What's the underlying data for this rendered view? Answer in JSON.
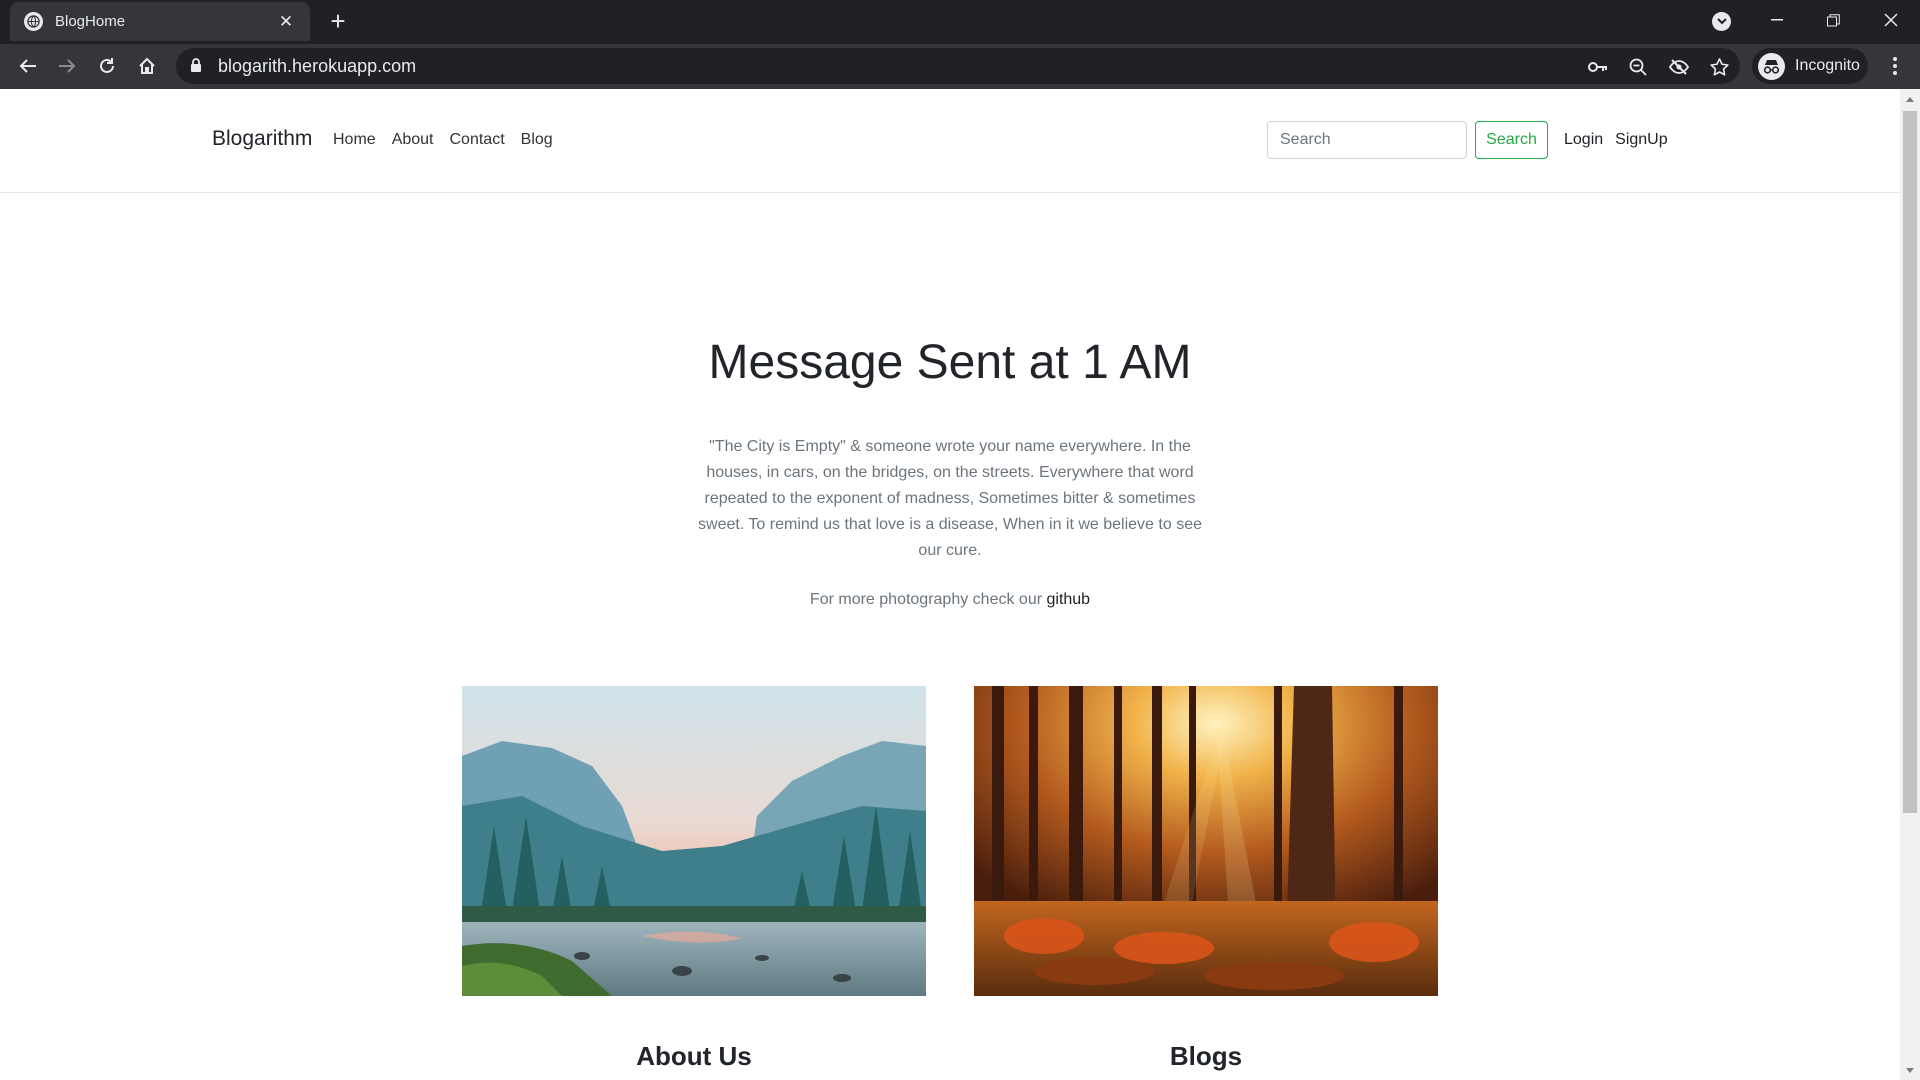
{
  "browser": {
    "tab_title": "BlogHome",
    "url": "blogarith.herokuapp.com",
    "profile_label": "Incognito"
  },
  "navbar": {
    "brand": "Blogarithm",
    "links": [
      "Home",
      "About",
      "Contact",
      "Blog"
    ],
    "search_placeholder": "Search",
    "search_button": "Search",
    "login": "Login",
    "signup": "SignUp"
  },
  "hero": {
    "title": "Message Sent at 1 AM",
    "text": "\"The City is Empty\" & someone wrote your name everywhere. In the houses, in cars, on the bridges, on the streets. Everywhere that word repeated to the exponent of madness, Sometimes bitter & sometimes sweet. To remind us that love is a disease, When in it we believe to see our cure.",
    "more_prefix": "For more photography check our ",
    "more_link": "github"
  },
  "sections": [
    {
      "title": "About Us"
    },
    {
      "title": "Blogs"
    }
  ],
  "colors": {
    "chrome_dark": "#202124",
    "chrome_tab": "#35363a",
    "success": "#28a745",
    "text": "#212529",
    "muted": "#6c757d"
  }
}
